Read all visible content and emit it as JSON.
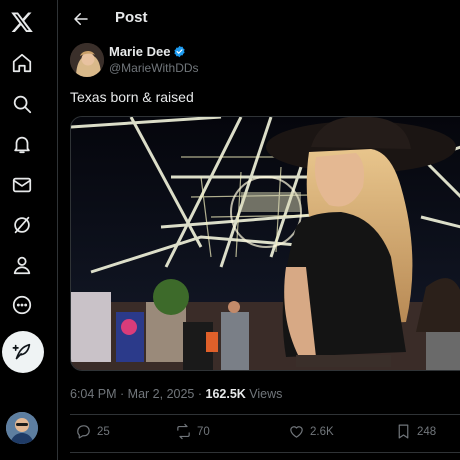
{
  "nav": {
    "items": [
      "home-icon",
      "search-icon",
      "notifications-icon",
      "messages-icon",
      "grok-icon",
      "profile-icon",
      "more-icon"
    ],
    "compose_icon": "compose-icon"
  },
  "header": {
    "title": "Post"
  },
  "post": {
    "author_name": "Marie Dee",
    "author_handle": "@MarieWithDDs",
    "text": "Texas born & raised",
    "time": "6:04 PM",
    "date": "Mar 2, 2025",
    "views_count": "162.5K",
    "views_label": "Views",
    "replies": "25",
    "reposts": "70",
    "likes": "2.6K",
    "bookmarks": "248"
  },
  "colors": {
    "background": "#000000",
    "text": "#e7e9ea",
    "secondary": "#71767b",
    "verified": "#1d9bf0",
    "divider": "#2f3336"
  }
}
